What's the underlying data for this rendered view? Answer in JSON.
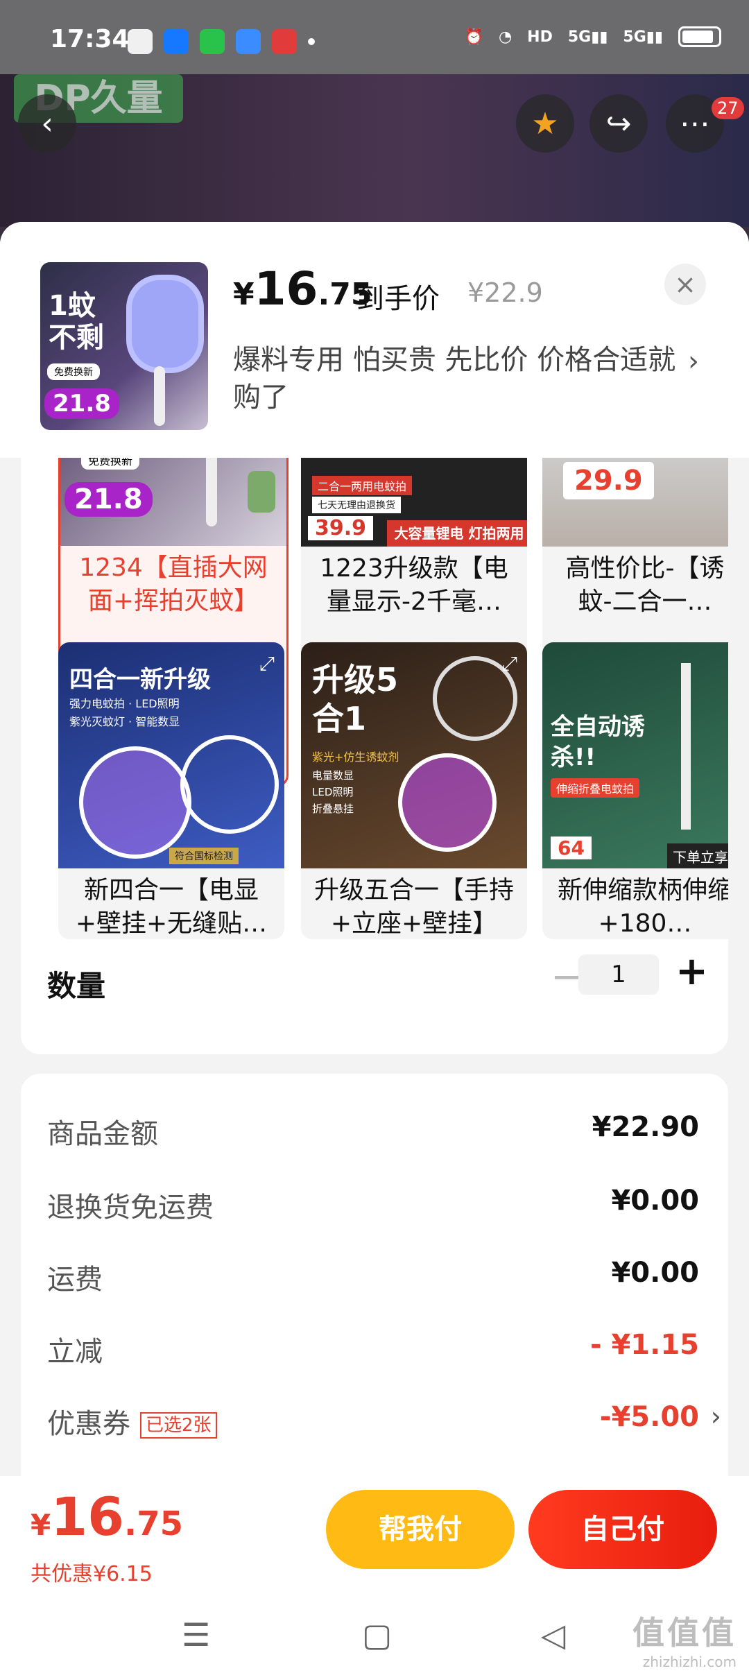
{
  "status_bar": {
    "time": "17:34",
    "app_icons": [
      "wechat-icon",
      "alipay-icon",
      "messages-icon",
      "cloud-icon",
      "pay-app-icon"
    ],
    "right_items": [
      "alarm-icon",
      "wifi-icon",
      "HD",
      "5G",
      "5G",
      "battery-icon"
    ]
  },
  "header": {
    "brand_logo_text": "DP久量",
    "notification_count": "27"
  },
  "sheet": {
    "price_symbol": "¥",
    "price_int": "16",
    "price_dec": ".75",
    "price_suffix": "到手价",
    "original_price": "¥22.9",
    "description": "爆料专用  怕买贵 先比价 价格合适就购了",
    "thumb": {
      "headline_line1": "1蚊",
      "headline_line2": "不剩",
      "tag": "免费换新",
      "promo_price": "21.8"
    }
  },
  "variants": {
    "row1": [
      {
        "label": "1234【直插大网面+挥拍灭蚊】",
        "selected": true,
        "promo": "21.8",
        "tag": "免费换新"
      },
      {
        "label": "1223升级款【电量显示-2千毫…",
        "selected": false,
        "promo": "39.9",
        "tag": "大容量锂电 灯拍两用",
        "tag2": "二合一两用电蚊拍",
        "tag3": "七天无理由退换货"
      },
      {
        "label": "高性价比-【诱蚊-二合一…",
        "selected": false,
        "promo": "29.9"
      }
    ],
    "row2": [
      {
        "label": "新四合一【电显+壁挂+无缝贴…",
        "selected": false,
        "banner": "四合一新升级",
        "features": [
          "强力电蚊拍",
          "LED照明",
          "紫光灭蚊灯",
          "智能数显"
        ],
        "cert": "符合国标检测"
      },
      {
        "label": "升级五合一【手持+立座+壁挂】",
        "selected": false,
        "banner": "升级5合1",
        "features": [
          "紫光+仿生诱蚊剂",
          "电量数显",
          "LED照明",
          "折叠悬挂"
        ]
      },
      {
        "label": "新伸缩款柄伸缩+180…",
        "selected": false,
        "banner": "全自动诱杀!!",
        "sub": "伸缩折叠电蚊拍",
        "promo": "64",
        "corner": "下单立享"
      }
    ]
  },
  "quantity": {
    "label": "数量",
    "minus": "−",
    "value": "1",
    "plus": "+"
  },
  "summary": {
    "rows": [
      {
        "label": "商品金额",
        "value": "¥22.90"
      },
      {
        "label": "退换货免运费",
        "value": "¥0.00"
      },
      {
        "label": "运费",
        "value": "¥0.00"
      },
      {
        "label": "立减",
        "value": "- ¥1.15"
      },
      {
        "label": "优惠券",
        "value": "-¥5.00",
        "tag": "已选2张"
      }
    ]
  },
  "paybar": {
    "price_symbol": "¥",
    "price_int": "16",
    "price_dec": ".75",
    "saving": "共优惠¥6.15",
    "help_pay": "帮我付",
    "self_pay": "自己付"
  },
  "watermark": {
    "big": "值值值",
    "small": "zhizhizhi.com"
  },
  "colors": {
    "accent_red": "#e8402e",
    "help_yellow": "#ffba14"
  }
}
